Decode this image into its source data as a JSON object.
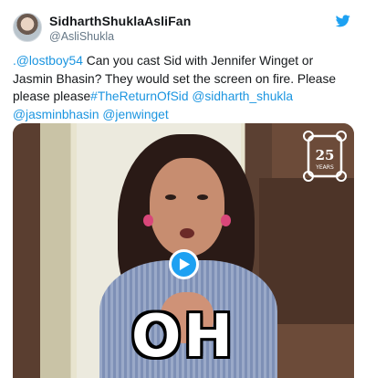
{
  "tweet": {
    "author": {
      "display_name": "SidharthShuklaAsliFan",
      "handle": "@AsliShukla",
      "avatar_icon": "avatar"
    },
    "brand_icon": "twitter-bird-icon",
    "brand_color": "#1da1f2",
    "link_color": "#1b95e0",
    "text": {
      "mention_1": ".@lostboy54",
      "body": " Can you cast Sid with Jennifer Winget or Jasmin Bhasin? They would set the screen on fire. Please please please",
      "hashtag": "#TheReturnOfSid",
      "mention_2": "@sidharth_shukla",
      "mention_3": "@jasminbhasin",
      "mention_4": "@jenwinget"
    },
    "media": {
      "type": "gif",
      "caption": "OH",
      "play_icon": "play-icon",
      "badge_icon": "friends-25-years-badge",
      "badge_text": "25",
      "badge_subtext": "YEARS"
    }
  }
}
